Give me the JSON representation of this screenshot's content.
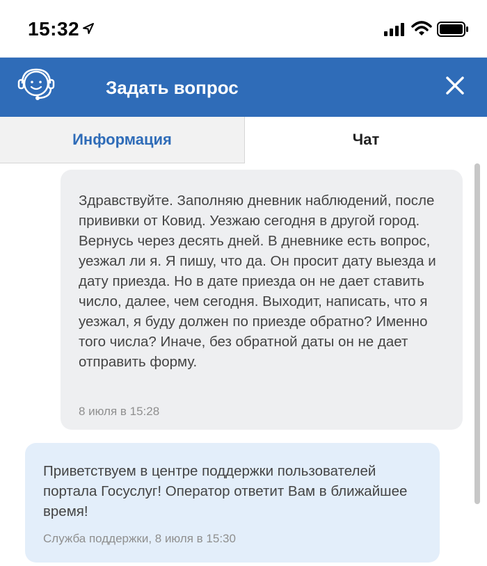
{
  "status_bar": {
    "time": "15:32"
  },
  "header": {
    "title": "Задать вопрос"
  },
  "tabs": [
    {
      "label": "Информация",
      "active": false
    },
    {
      "label": "Чат",
      "active": true
    }
  ],
  "messages": [
    {
      "sender": "user",
      "text": "Здравствуйте. Заполняю дневник наблюдений, после прививки от Ковид. Уезжаю сегодня в другой город. Вернусь через десять дней. В дневнике есть вопрос, уезжал ли я. Я пишу, что да. Он просит дату выезда и дату приезда. Но в дате приезда он не дает ставить число, далее, чем сегодня. Выходит, написать, что я уезжал, я буду должен по приезде обратно? Именно того числа? Иначе, без обратной даты он не дает отправить форму.",
      "time": "8 июля в 15:28"
    },
    {
      "sender": "support",
      "text": "Приветствуем в центре поддержки пользователей портала Госуслуг! Оператор ответит Вам в ближайшее время!",
      "meta": "Служба поддержки, 8 июля в 15:30"
    }
  ],
  "colors": {
    "brand_blue": "#2f6cb8",
    "user_bubble": "#eeeff1",
    "support_bubble": "#e3eefa"
  },
  "icons": [
    "location-arrow-icon",
    "signal-icon",
    "wifi-icon",
    "battery-icon",
    "support-operator-icon",
    "close-icon"
  ]
}
